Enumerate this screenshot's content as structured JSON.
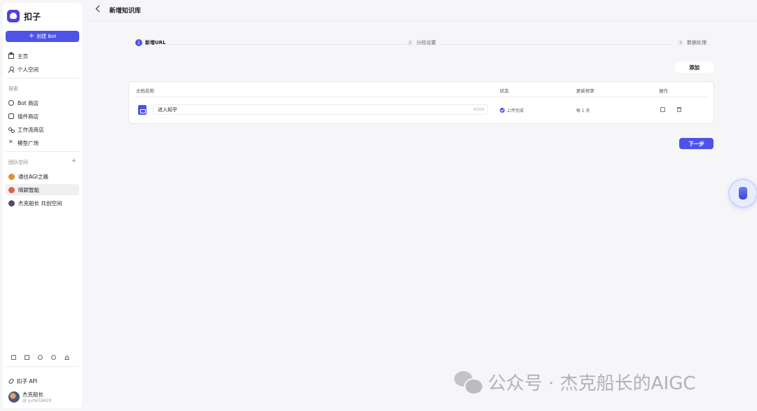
{
  "brand": {
    "name": "扣子"
  },
  "sidebar": {
    "create_label": "创建 Bot",
    "nav": [
      {
        "label": "主页"
      },
      {
        "label": "个人空间"
      }
    ],
    "explore_label": "探索",
    "explore": [
      {
        "label": "Bot 商店"
      },
      {
        "label": "插件商店"
      },
      {
        "label": "工作流商店"
      },
      {
        "label": "模型广场"
      }
    ],
    "team_label": "团队空间",
    "team_plus": "+",
    "teams": [
      {
        "label": "通往AGI之路",
        "color": "#d9922f"
      },
      {
        "label": "晴颖智能",
        "color": "#e0604a"
      },
      {
        "label": "杰克船长 共创空间",
        "color": "#5a4a6a"
      }
    ],
    "api_label": "扣子 API",
    "profile": {
      "name": "杰克船长",
      "id": "@ yvhk59420"
    }
  },
  "header": {
    "title": "新增知识库"
  },
  "steps": [
    {
      "num": "1",
      "label": "新增URL"
    },
    {
      "num": "2",
      "label": "分段设置"
    },
    {
      "num": "3",
      "label": "数据处理"
    }
  ],
  "add_label": "添加",
  "table": {
    "headers": {
      "name": "文档名称",
      "status": "状态",
      "frequency": "更新频率",
      "actions": "操作"
    },
    "rows": [
      {
        "name": "进入知乎",
        "count": "4/100",
        "status": "上传完成",
        "frequency": "每 1 天"
      }
    ]
  },
  "next_label": "下一步",
  "watermark": "公众号 · 杰克船长的AIGC",
  "colors": {
    "accent": "#4d53e8",
    "background": "#f6f6f9"
  }
}
